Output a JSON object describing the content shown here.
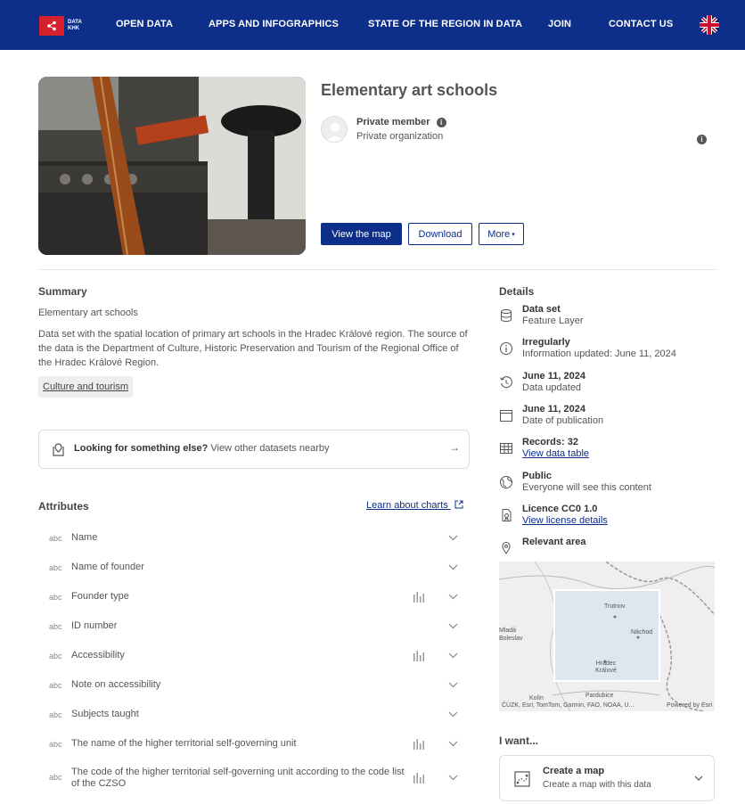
{
  "nav": {
    "logo_line1": "DATA",
    "logo_line2": "KHK",
    "items": [
      "OPEN DATA",
      "APPS AND INFOGRAPHICS",
      "STATE OF THE REGION IN DATA",
      "JOIN",
      "CONTACT US"
    ]
  },
  "item": {
    "title": "Elementary art schools",
    "owner_name": "Private member",
    "owner_org": "Private organization",
    "buttons": {
      "view_map": "View the map",
      "download": "Download",
      "more": "More"
    }
  },
  "summary": {
    "heading": "Summary",
    "short": "Elementary art schools",
    "description": "Data set with the spatial location of primary art schools in the Hradec Králové region. The source of the data is the Department of Culture, Historic Preservation and Tourism of the Regional Office of the Hradec Králové Region.",
    "tag": "Culture and tourism"
  },
  "search": {
    "bold": "Looking for something else?",
    "rest": " View other datasets nearby"
  },
  "attributes": {
    "heading": "Attributes",
    "learn_link": "Learn about charts",
    "type_label": "abc",
    "items": [
      {
        "name": "Name",
        "chart": false
      },
      {
        "name": "Name of founder",
        "chart": false
      },
      {
        "name": "Founder type",
        "chart": true
      },
      {
        "name": "ID number",
        "chart": false
      },
      {
        "name": "Accessibility",
        "chart": true
      },
      {
        "name": "Note on accessibility",
        "chart": false
      },
      {
        "name": "Subjects taught",
        "chart": false
      },
      {
        "name": "The name of the higher territorial self-governing unit",
        "chart": true
      },
      {
        "name": "The code of the higher territorial self-governing unit according to the code list of the CZSO",
        "chart": true
      }
    ]
  },
  "details": {
    "heading": "Details",
    "items": [
      {
        "icon": "database-icon",
        "title": "Data set",
        "sub": "Feature Layer"
      },
      {
        "icon": "info-icon",
        "title": "Irregularly",
        "sub": "Information updated: June 11, 2024"
      },
      {
        "icon": "history-icon",
        "title": "June 11, 2024",
        "sub": "Data updated"
      },
      {
        "icon": "calendar-icon",
        "title": "June 11, 2024",
        "sub": "Date of publication"
      },
      {
        "icon": "table-icon",
        "title": "Records: 32",
        "link": "View data table"
      },
      {
        "icon": "globe-icon",
        "title": "Public",
        "sub": "Everyone will see this content"
      },
      {
        "icon": "license-icon",
        "title": "Licence CC0 1.0",
        "link": "View license details"
      },
      {
        "icon": "pin-icon",
        "title": "Relevant area"
      }
    ],
    "map_labels": [
      "Trutnov",
      "Náchod",
      "Hradec Králové",
      "Pardubice",
      "Kolín",
      "Mladá Boleslav"
    ],
    "map_credit": "ČÚZK, Esri, TomTom, Garmin, FAO, NOAA, U...",
    "map_powered": "Powered by Esri"
  },
  "want": {
    "heading": "I want...",
    "title": "Create a map",
    "sub": "Create a map with this data"
  }
}
